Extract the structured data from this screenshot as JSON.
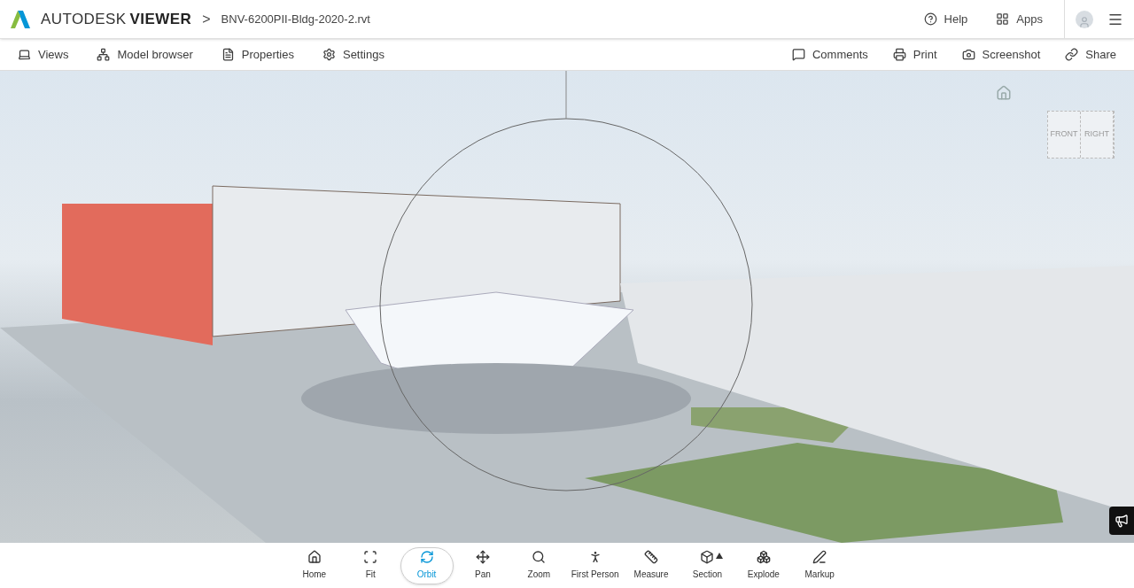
{
  "header": {
    "brand": "AUTODESK",
    "product": "VIEWER",
    "separator": ">",
    "file_name": "BNV-6200PII-Bldg-2020-2.rvt",
    "links": [
      {
        "kind": "help",
        "label": "Help"
      },
      {
        "kind": "apps",
        "label": "Apps"
      }
    ]
  },
  "toolbar": {
    "left": [
      {
        "kind": "views",
        "label": "Views"
      },
      {
        "kind": "model",
        "label": "Model browser"
      },
      {
        "kind": "properties",
        "label": "Properties"
      },
      {
        "kind": "settings",
        "label": "Settings"
      }
    ],
    "right": [
      {
        "kind": "comments",
        "label": "Comments"
      },
      {
        "kind": "print",
        "label": "Print"
      },
      {
        "kind": "screenshot",
        "label": "Screenshot"
      },
      {
        "kind": "share",
        "label": "Share"
      }
    ]
  },
  "view_cube": {
    "faces": [
      "FRONT",
      "RIGHT"
    ]
  },
  "tools": [
    {
      "kind": "home",
      "label": "Home",
      "selected": false
    },
    {
      "kind": "fit",
      "label": "Fit",
      "selected": false
    },
    {
      "kind": "orbit",
      "label": "Orbit",
      "selected": true
    },
    {
      "kind": "pan",
      "label": "Pan",
      "selected": false
    },
    {
      "kind": "zoom",
      "label": "Zoom",
      "selected": false
    },
    {
      "kind": "person",
      "label": "First Person",
      "selected": false
    },
    {
      "kind": "measure",
      "label": "Measure",
      "selected": false
    },
    {
      "kind": "section",
      "label": "Section",
      "selected": false,
      "has_menu": true
    },
    {
      "kind": "explode",
      "label": "Explode",
      "selected": false
    },
    {
      "kind": "markup",
      "label": "Markup",
      "selected": false
    }
  ]
}
